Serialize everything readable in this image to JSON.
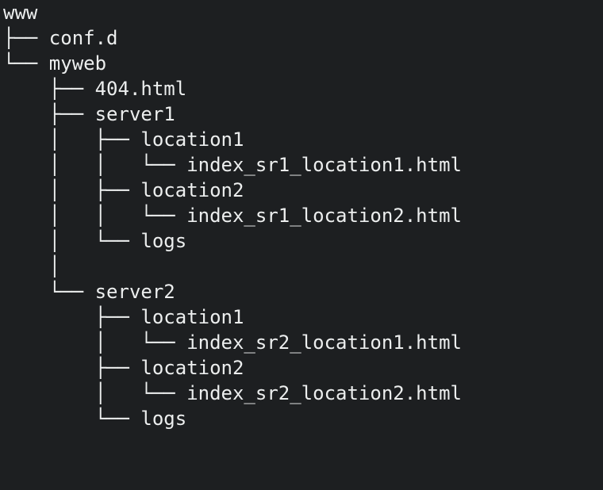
{
  "tree": {
    "lines": [
      "www",
      "├── conf.d",
      "└── myweb",
      "    ├── 404.html",
      "    ├── server1",
      "    │   ├── location1",
      "    │   │   └── index_sr1_location1.html",
      "    │   ├── location2",
      "    │   │   └── index_sr1_location2.html",
      "    │   └── logs",
      "    │",
      "    └── server2",
      "        ├── location1",
      "        │   └── index_sr2_location1.html",
      "        ├── location2",
      "        │   └── index_sr2_location2.html",
      "        └── logs"
    ]
  },
  "nodes": {
    "root": "www",
    "conf_d": "conf.d",
    "myweb": "myweb",
    "file_404": "404.html",
    "server1": "server1",
    "s1_loc1": "location1",
    "s1_loc1_index": "index_sr1_location1.html",
    "s1_loc2": "location2",
    "s1_loc2_index": "index_sr1_location2.html",
    "s1_logs": "logs",
    "server2": "server2",
    "s2_loc1": "location1",
    "s2_loc1_index": "index_sr2_location1.html",
    "s2_loc2": "location2",
    "s2_loc2_index": "index_sr2_location2.html",
    "s2_logs": "logs"
  }
}
